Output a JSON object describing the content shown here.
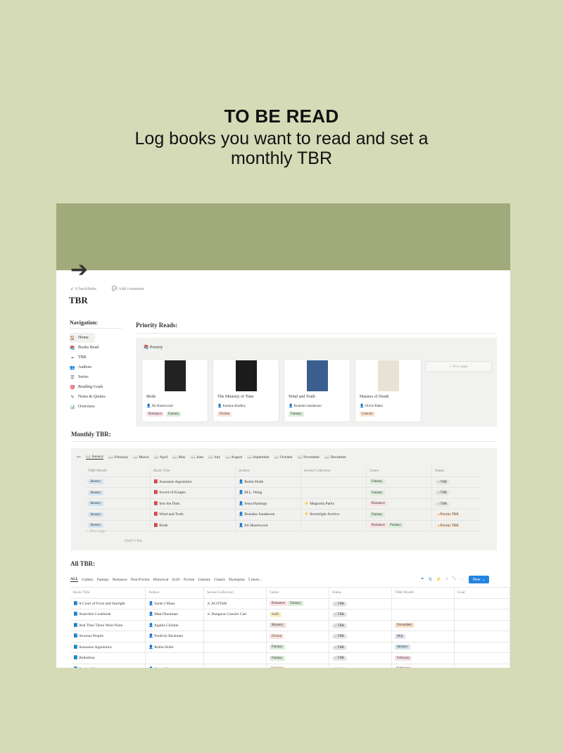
{
  "hero": {
    "title": "TO BE READ",
    "subtitle": "Log books you want to read and set a monthly TBR"
  },
  "page": {
    "backlinks": "6 backlinks",
    "add_comment": "Add comment",
    "title": "TBR"
  },
  "nav": {
    "heading": "Navigation:",
    "items": [
      {
        "icon": "🏠",
        "label": "Home"
      },
      {
        "icon": "📚",
        "label": "Books Read"
      },
      {
        "icon": "➢",
        "label": "TBR"
      },
      {
        "icon": "👥",
        "label": "Authors"
      },
      {
        "icon": "☰",
        "label": "Series"
      },
      {
        "icon": "🎯",
        "label": "Reading Goals"
      },
      {
        "icon": "✎",
        "label": "Notes & Quotes"
      },
      {
        "icon": "📊",
        "label": "Overview"
      }
    ]
  },
  "priority": {
    "heading": "Priority Reads:",
    "view_label": "Priority",
    "new_page": "+ New page",
    "cards": [
      {
        "title": "Bride",
        "author": "Ali Hazelwood",
        "tags": [
          "Romance",
          "Fantasy"
        ],
        "cover": "#222"
      },
      {
        "title": "The Ministry of Time",
        "author": "Kaliane Bradley",
        "tags": [
          "Fiction"
        ],
        "cover": "#1c1c1c"
      },
      {
        "title": "Wind and Truth",
        "author": "Brandon Sanderson",
        "tags": [
          "Fantasy"
        ],
        "cover": "#3a5f8f"
      },
      {
        "title": "Masters of Death",
        "author": "Olivie Blake",
        "tags": [
          "Literary"
        ],
        "cover": "#e8e2d4"
      }
    ]
  },
  "monthly": {
    "heading": "Monthly TBR:",
    "months": [
      "January",
      "February",
      "March",
      "April",
      "May",
      "June",
      "July",
      "August",
      "September",
      "October",
      "November",
      "December"
    ],
    "columns": [
      "TBR Month",
      "Book Title",
      "Author",
      "Series/Collection",
      "Genre",
      "Status"
    ],
    "rows": [
      {
        "month": "January",
        "title": "Assassins Apprentice",
        "author": "Robin Hobb",
        "series": "",
        "genre": [
          "Fantasy"
        ],
        "status": "TBR"
      },
      {
        "month": "January",
        "title": "Sword of Kaigen",
        "author": "M.L. Wang",
        "series": "",
        "genre": [
          "Fantasy"
        ],
        "status": "TBR"
      },
      {
        "month": "January",
        "title": "Into the Dark",
        "author": "Jessa Hastings",
        "series": "Magnolia Parks",
        "genre": [
          "Romance"
        ],
        "status": "TBR"
      },
      {
        "month": "January",
        "title": "Wind and Truth",
        "author": "Brandon Sanderson",
        "series": "Stormlight Archive",
        "genre": [
          "Fantasy"
        ],
        "status": "Priority TBR"
      },
      {
        "month": "January",
        "title": "Bride",
        "author": "Ali Hazelwood",
        "series": "",
        "genre": [
          "Romance",
          "Fantasy"
        ],
        "status": "Priority TBR"
      }
    ],
    "new_page": "+ New page",
    "count_label": "EMPTY",
    "count_value": "0%"
  },
  "all": {
    "heading": "All TBR:",
    "tabs": [
      "ALL",
      "Gallery",
      "Fantasy",
      "Romance",
      "Non-Fiction",
      "Historical",
      "SciFi",
      "Fiction",
      "Literary",
      "Classic",
      "Dystopian",
      "5 more..."
    ],
    "new_button": "New",
    "columns": [
      "Book Title",
      "Author",
      "Series/Collection",
      "Genre",
      "Status",
      "TBR Month",
      "Goal"
    ],
    "rows": [
      {
        "title": "A Court of Frost and Starlight",
        "author": "Sarah J Maas",
        "series": "ACOTAR",
        "genre": [
          "Romance",
          "Fantasy"
        ],
        "status": "TBR",
        "month": ""
      },
      {
        "title": "Anarchist Cookbook",
        "author": "Matt Dinniman",
        "series": "Dungeon Crawler Carl",
        "genre": [
          "SciFi"
        ],
        "status": "TBR",
        "month": ""
      },
      {
        "title": "And Then There Were None",
        "author": "Agatha Christie",
        "series": "",
        "genre": [
          "Mystery"
        ],
        "status": "TBR",
        "month": "November"
      },
      {
        "title": "Anxious People",
        "author": "Fredrick Backman",
        "series": "",
        "genre": [
          "Fiction"
        ],
        "status": "TBR",
        "month": "May"
      },
      {
        "title": "Assassins Apprentice",
        "author": "Robin Hobb",
        "series": "",
        "genre": [
          "Fantasy"
        ],
        "status": "TBR",
        "month": "January"
      },
      {
        "title": "Belladona",
        "author": "",
        "series": "",
        "genre": [
          "Fantasy"
        ],
        "status": "TBR",
        "month": "February"
      },
      {
        "title": "Book of Doors",
        "author": "Gareth Brown",
        "series": "",
        "genre": [
          "Literary"
        ],
        "status": "TBR",
        "month": "February"
      }
    ]
  },
  "colors": {
    "Romance": "#f9e0e6",
    "Fantasy": "#dbeddb",
    "Fiction": "#fde2dd",
    "Literary": "#fde6d2",
    "SciFi": "#fbf0c8",
    "Mystery": "#eee0da",
    "January": "#d3e5ef",
    "February": "#f5e0e9",
    "May": "#e8deee",
    "November": "#fadec9"
  }
}
